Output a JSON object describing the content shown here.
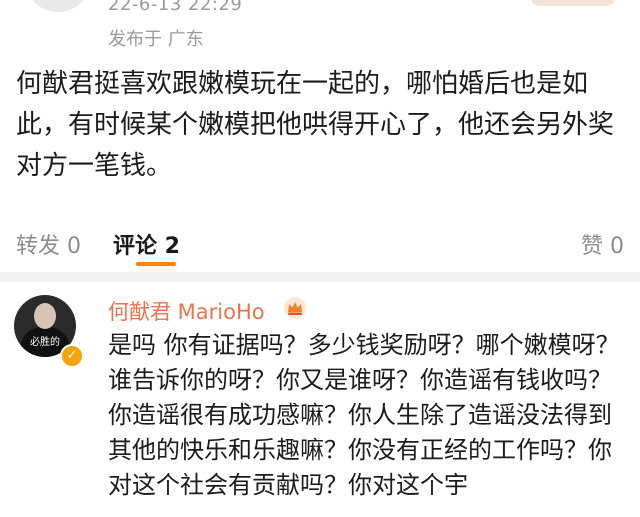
{
  "post": {
    "date": "22-6-13 22:29",
    "location": "发布于 广东",
    "body": "何猷君挺喜欢跟嫩模玩在一起的，哪怕婚后也是如此，有时候某个嫩模把他哄得开心了，他还会另外奖对方一笔钱。"
  },
  "actions": {
    "repost": "转发 0",
    "comment": "评论 2",
    "like": "赞 0"
  },
  "comment": {
    "author": "何猷君 MarioHo",
    "avatar_text": "必胜的",
    "verified_glyph": "✓",
    "text": "是吗 你有证据吗？多少钱奖励呀？哪个嫩模呀？谁告诉你的呀？你又是谁呀？你造谣有钱收吗？你造谣很有成功感嘛？你人生除了造谣没法得到其他的快乐和乐趣嘛？你没有正经的工作吗？你对这个社会有贡献吗？你对这个宇"
  },
  "icons": {
    "crown": "crown-icon",
    "verified": "verified-badge-icon"
  },
  "colors": {
    "accent": "#ff8200",
    "author_name": "#eb7350",
    "muted_text": "#9a9a9a",
    "divider": "#f2f2f2"
  }
}
